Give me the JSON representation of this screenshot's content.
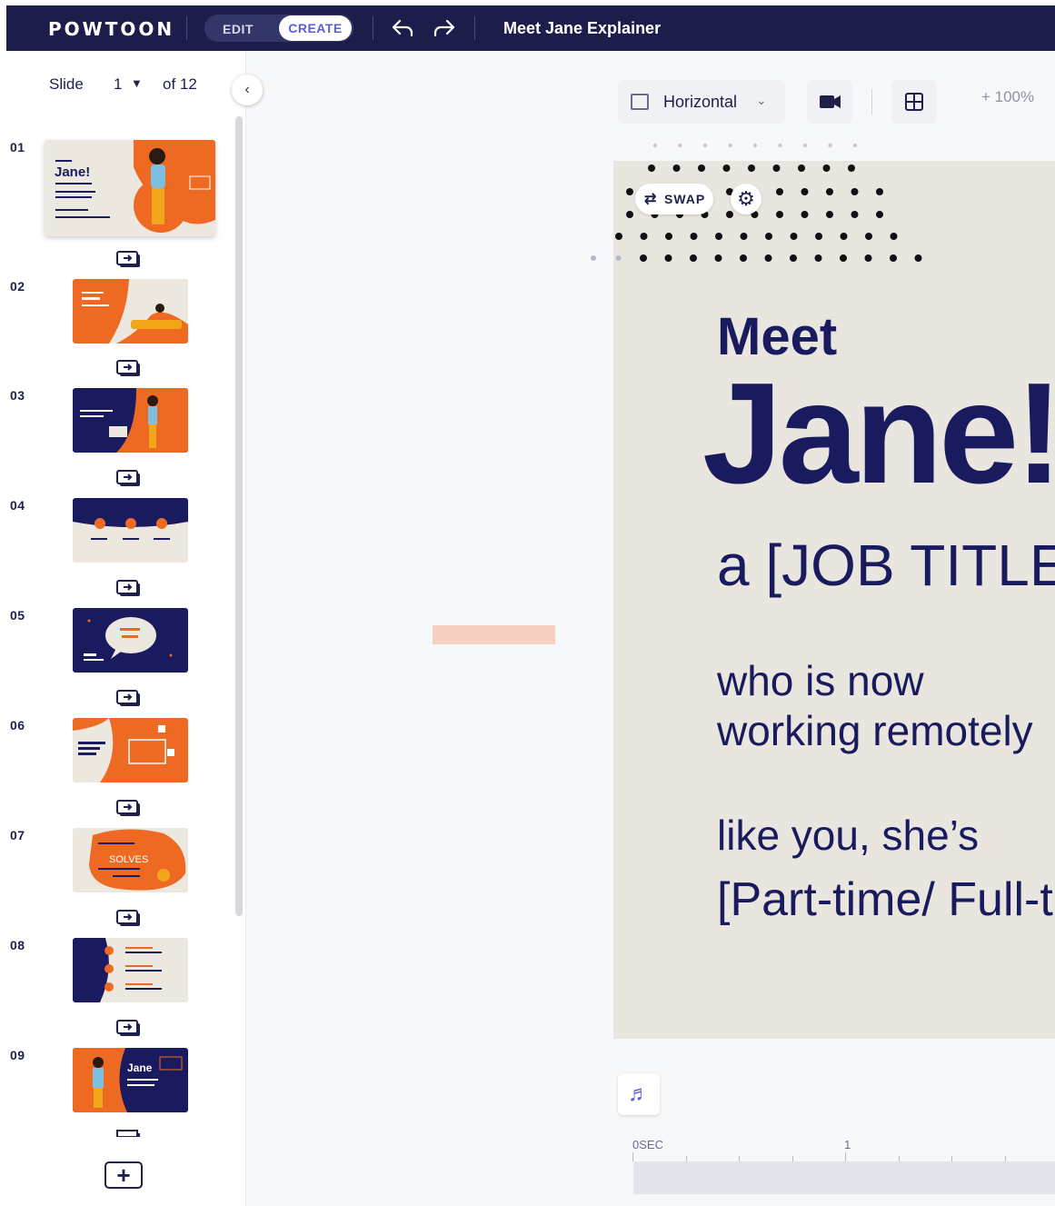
{
  "topbar": {
    "logo": "POWTOON",
    "edit_label": "EDIT",
    "create_label": "CREATE",
    "doc_title": "Meet Jane Explainer"
  },
  "slides_panel": {
    "slide_label": "Slide",
    "current_slide": "1",
    "of_total": "of 12",
    "slides": [
      {
        "number": "01",
        "thumb_text": "Jane!"
      },
      {
        "number": "02"
      },
      {
        "number": "03"
      },
      {
        "number": "04"
      },
      {
        "number": "05"
      },
      {
        "number": "06"
      },
      {
        "number": "07",
        "thumb_text": "SOLVES"
      },
      {
        "number": "08"
      },
      {
        "number": "09",
        "thumb_text": "Jane"
      }
    ]
  },
  "toolbar": {
    "orientation": "Horizontal",
    "zoom": "+ 100%"
  },
  "canvas": {
    "swap_label": "SWAP",
    "meet": "Meet",
    "name": "Jane!",
    "job_line": "a [JOB TITLE]",
    "line1": "who is now",
    "line2": "working remotely",
    "line3": "like you, she’s",
    "line4": "[Part-time/ Full-time]"
  },
  "timeline": {
    "start_label": "0SEC",
    "mark_1": "1"
  },
  "colors": {
    "topbar": "#1c1d4a",
    "accent": "#5b5ed8",
    "navy": "#1a1a5e",
    "orange": "#ee6a23",
    "beige": "#e9e6df"
  }
}
